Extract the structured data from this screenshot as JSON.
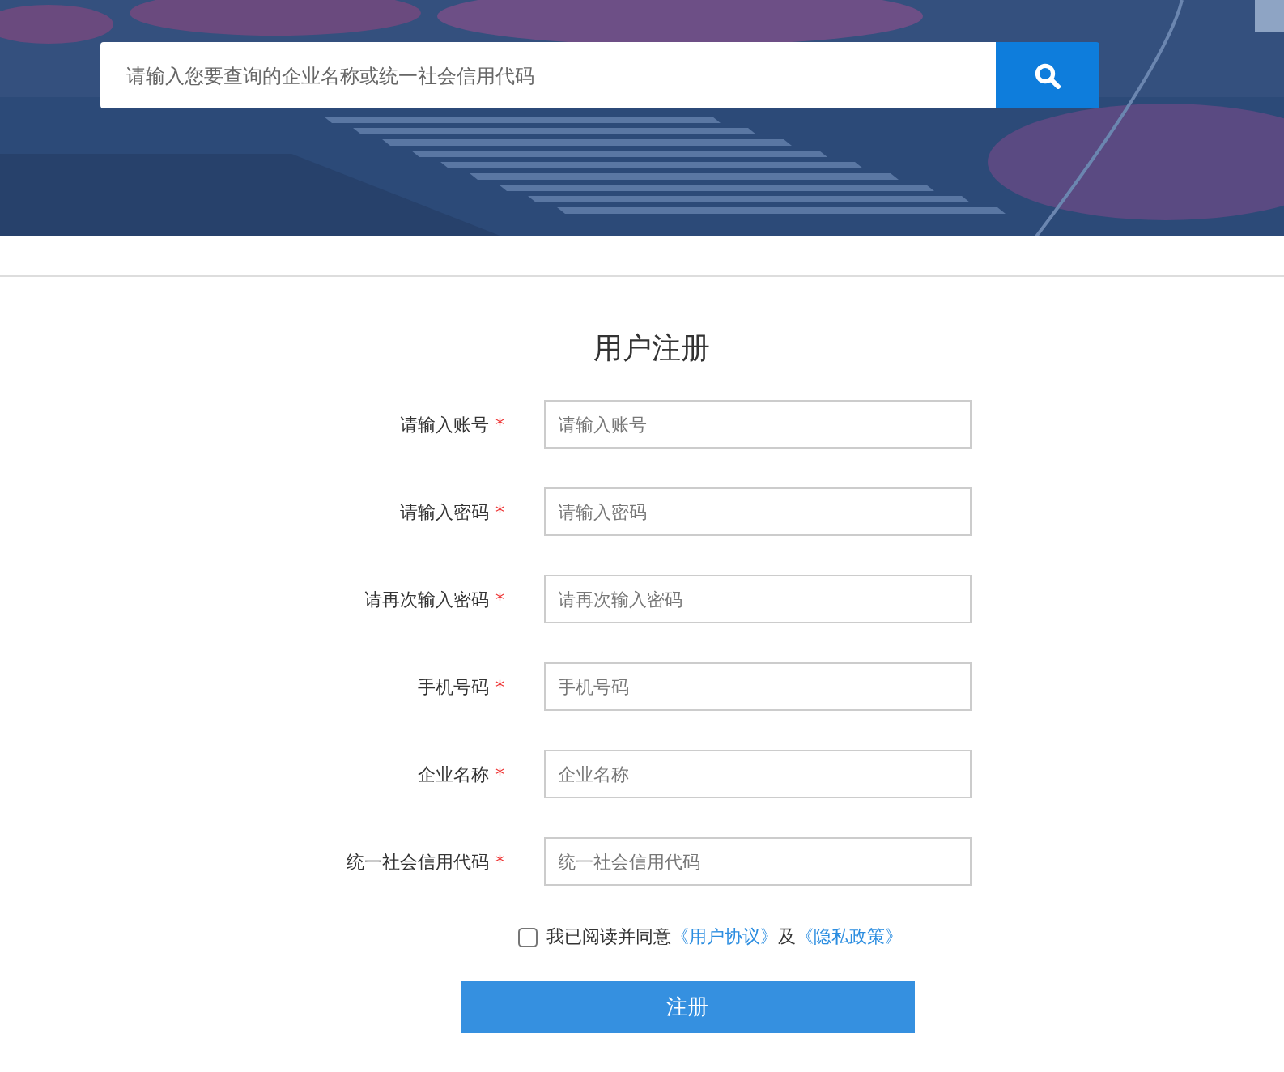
{
  "banner": {
    "kind": "picture",
    "search": {
      "placeholder": "请输入您要查询的企业名称或统一社会信用代码"
    }
  },
  "form": {
    "title": "用户注册",
    "fields": [
      {
        "label": "请输入账号",
        "required_mark": "*",
        "placeholder": "请输入账号"
      },
      {
        "label": "请输入密码",
        "required_mark": "*",
        "placeholder": "请输入密码"
      },
      {
        "label": "请再次输入密码",
        "required_mark": "*",
        "placeholder": "请再次输入密码"
      },
      {
        "label": "手机号码",
        "required_mark": "*",
        "placeholder": "手机号码"
      },
      {
        "label": "企业名称",
        "required_mark": "*",
        "placeholder": "企业名称"
      },
      {
        "label": "统一社会信用代码",
        "required_mark": "*",
        "placeholder": "统一社会信用代码"
      }
    ],
    "agreement": {
      "checked": false,
      "text": "我已阅读并同意",
      "link_1": "《用户协议》",
      "joiner": "及",
      "link_2": "《隐私政策》"
    },
    "submit": "注册"
  }
}
